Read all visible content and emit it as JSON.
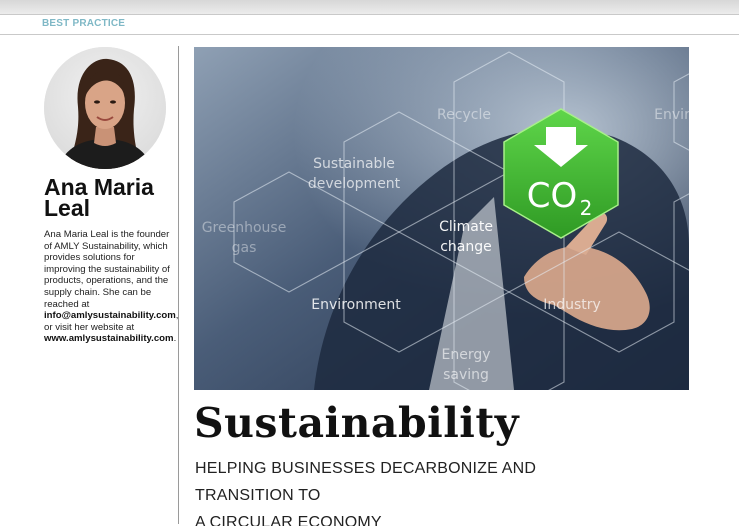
{
  "header": {
    "section_label": "BEST PRACTICE"
  },
  "author": {
    "name": "Ana Maria Leal",
    "bio_intro": "Ana Maria Leal is the founder of AMLY Sustainability, which provides solutions for improving the sustainability of products, operations, and the supply chain. She can be reached at ",
    "email": "info@amlysustainability.com",
    "bio_middle": ", or visit her website at ",
    "website": "www.amlysustainability.com",
    "bio_end": "."
  },
  "hero_image": {
    "labels": {
      "recycle": "Recycle",
      "envir_partial": "Envir",
      "sustainable_1": "Sustainable",
      "sustainable_2": "development",
      "greenhouse_1": "Greenhouse",
      "greenhouse_2": "gas",
      "climate_1": "Climate",
      "climate_2": "change",
      "environment": "Environment",
      "industry": "Industry",
      "energy_1": "Energy",
      "energy_2": "saving",
      "co2_main": "CO",
      "co2_sub": "2"
    },
    "colors": {
      "hex_green": "#3fb52e",
      "background": "#2c3f5c"
    }
  },
  "article": {
    "title": "Sustainability",
    "subtitle_line1": "HELPING BUSINESSES DECARBONIZE AND TRANSITION TO",
    "subtitle_line2": "A CIRCULAR ECONOMY"
  }
}
